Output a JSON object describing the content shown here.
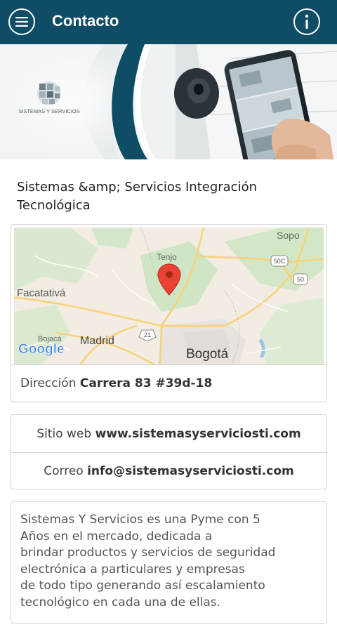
{
  "appbar": {
    "title": "Contacto",
    "menu_icon": "hamburger-menu-icon",
    "info_icon": "info-icon",
    "background": "#0f4d66"
  },
  "banner": {
    "logo_text": "SISTEMAS Y SERVICIOS"
  },
  "company": {
    "name": "Sistemas &amp; Servicios Integración Tecnológica"
  },
  "map": {
    "labels": {
      "sopo": "Sopo",
      "tenjo": "Tenjo",
      "facatativa": "Facatativá",
      "bojaca": "Bojacá",
      "madrid": "Madrid",
      "bogota": "Bogotá",
      "road_50c": "50C",
      "road_50": "50",
      "road_21": "21"
    },
    "attribution": "Google"
  },
  "address": {
    "label": "Dirección",
    "value": "Carrera 83 #39d-18"
  },
  "web": {
    "label": "Sitio web",
    "value": "www.sistemasyserviciosti.com"
  },
  "email": {
    "label": "Correo",
    "value": "info@sistemasyserviciosti.com"
  },
  "description": {
    "text": "Sistemas Y Servicios es una Pyme con 5\nAños en el mercado, dedicada a\nbrindar productos y servicios de seguridad\nelectrónica a particulares y empresas\nde todo tipo generando así escalamiento\ntecnológico en cada una de ellas."
  }
}
